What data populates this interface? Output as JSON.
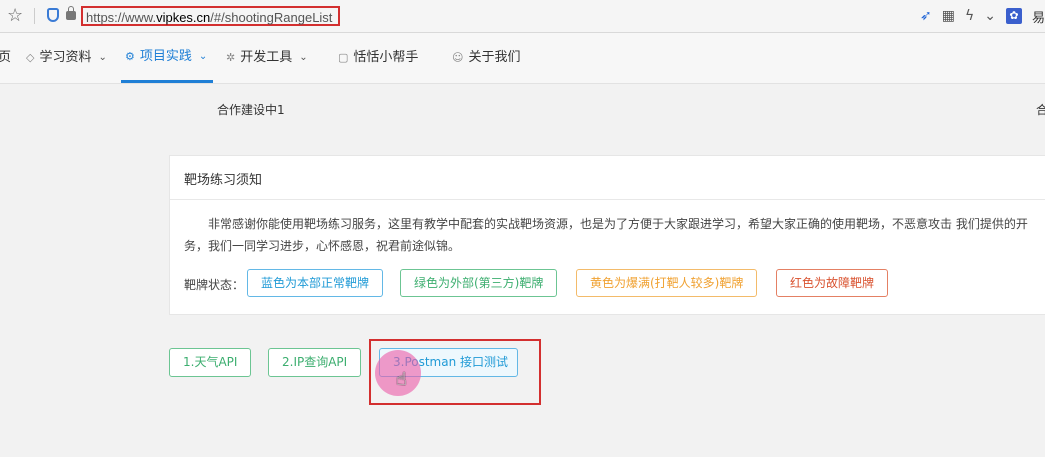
{
  "browser": {
    "url_prefix": "https://www.",
    "url_domain": "vipkes.cn",
    "url_path": "/#/shootingRangeList",
    "right_icons": [
      "rocket-icon",
      "grid-icon",
      "lightning-icon",
      "chevron-down-icon",
      "baidu-icon"
    ],
    "right_trunc_text": "易"
  },
  "nav": {
    "items": [
      {
        "label": "页",
        "icon": "",
        "caret": ""
      },
      {
        "label": "学习资料",
        "icon": "◇",
        "caret": "⌄"
      },
      {
        "label": "项目实践",
        "icon": "⚙",
        "caret": "⌄"
      },
      {
        "label": "开发工具",
        "icon": "✲",
        "caret": "⌄"
      },
      {
        "label": "恬恬小帮手",
        "icon": "▢",
        "caret": ""
      },
      {
        "label": "关于我们",
        "icon": "☺",
        "caret": ""
      }
    ]
  },
  "partners": {
    "left": "合作建设中1",
    "right": "合"
  },
  "panel": {
    "title": "靶场练习须知",
    "line1": "非常感谢你能使用靶场练习服务，这里有教学中配套的实战靶场资源，也是为了方便于大家跟进学习，希望大家正确的使用靶场，不恶意攻击 我们提供的开",
    "line2": "务，我们一同学习进步，心怀感恩，祝君前途似锦。",
    "status_label": "靶牌状态：",
    "tags": [
      "蓝色为本部正常靶牌",
      "绿色为外部(第三方)靶牌",
      "黄色为爆满(打靶人较多)靶牌",
      "红色为故障靶牌"
    ]
  },
  "ranges": [
    "1.天气API",
    "2.IP查询API",
    "3.Postman 接口测试"
  ],
  "colors": {
    "accent": "#1f7fd6",
    "highlight": "#d32f2f",
    "green": "#3cae6f",
    "blue": "#1f9ad6",
    "orange": "#f0a131",
    "red": "#d9522f"
  }
}
